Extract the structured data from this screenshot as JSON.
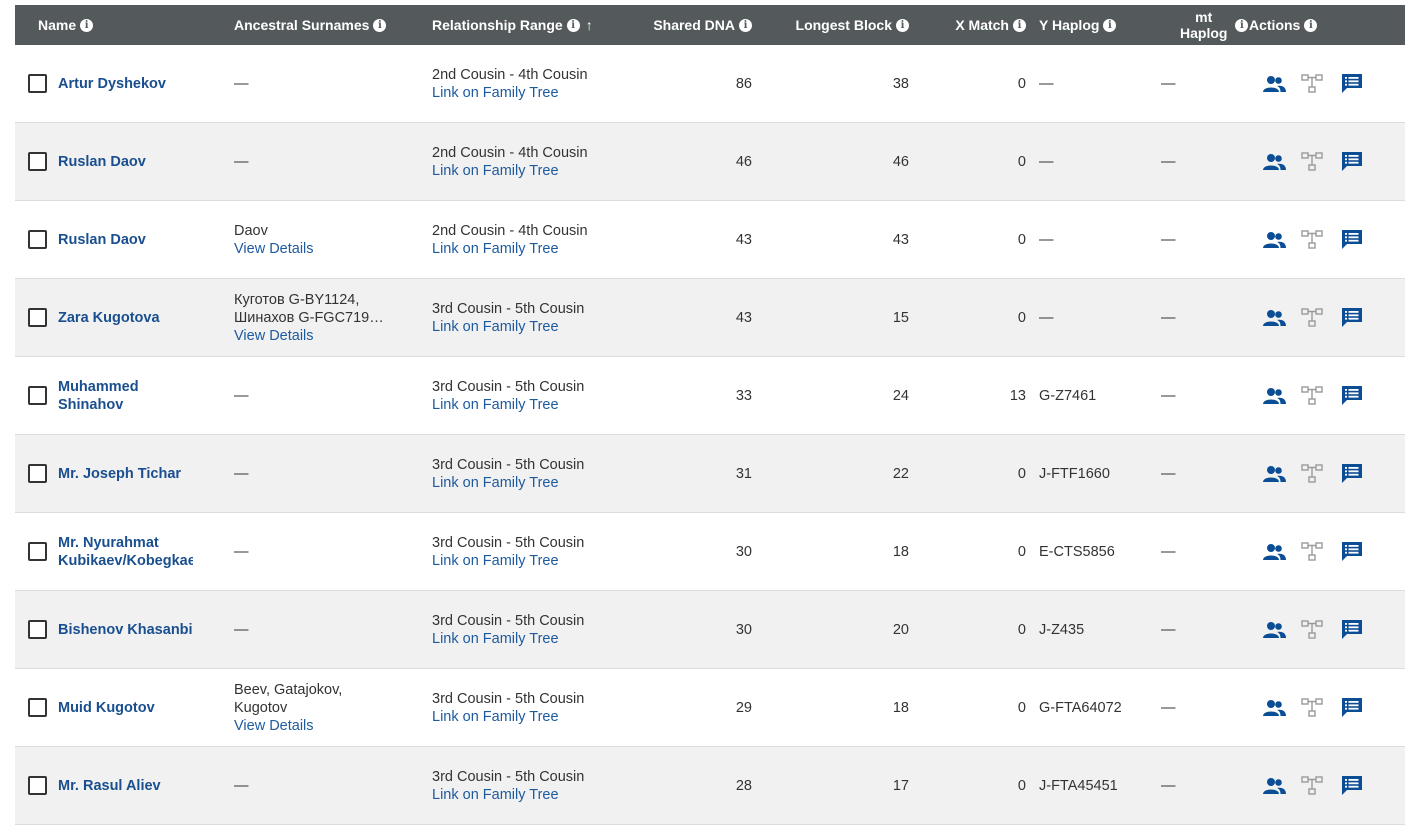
{
  "header": {
    "name": "Name",
    "surnames": "Ancestral Surnames",
    "relationship": "Relationship Range",
    "shared_dna": "Shared DNA",
    "longest_block": "Longest Block",
    "x_match": "X Match",
    "y_haplog": "Y Haplog",
    "mt_haplog_line1": "mt",
    "mt_haplog_line2": "Haplog",
    "actions": "Actions",
    "info_glyph": "i",
    "sort_glyph": "↑"
  },
  "rows": [
    {
      "name1": "Artur Dyshekov",
      "name2": "",
      "surn1": "—",
      "surn2": "",
      "surn_link": "",
      "rel": "2nd Cousin - 4th Cousin",
      "rel_link": "Link on Family Tree",
      "dna": "86",
      "block": "38",
      "x": "0",
      "y": "—",
      "mt": "—"
    },
    {
      "name1": "Ruslan Daov",
      "name2": "",
      "surn1": "—",
      "surn2": "",
      "surn_link": "",
      "rel": "2nd Cousin - 4th Cousin",
      "rel_link": "Link on Family Tree",
      "dna": "46",
      "block": "46",
      "x": "0",
      "y": "—",
      "mt": "—"
    },
    {
      "name1": "Ruslan Daov",
      "name2": "",
      "surn1": "Daov",
      "surn2": "",
      "surn_link": "View Details",
      "rel": "2nd Cousin - 4th Cousin",
      "rel_link": "Link on Family Tree",
      "dna": "43",
      "block": "43",
      "x": "0",
      "y": "—",
      "mt": "—"
    },
    {
      "name1": "Zara Kugotova",
      "name2": "",
      "surn1": "Куготов G-BY1124,",
      "surn2": "Шинахов G-FGC719,...",
      "surn_link": "View Details",
      "rel": "3rd Cousin - 5th Cousin",
      "rel_link": "Link on Family Tree",
      "dna": "43",
      "block": "15",
      "x": "0",
      "y": "—",
      "mt": "—"
    },
    {
      "name1": "Muhammed",
      "name2": "Shinahov",
      "surn1": "—",
      "surn2": "",
      "surn_link": "",
      "rel": "3rd Cousin - 5th Cousin",
      "rel_link": "Link on Family Tree",
      "dna": "33",
      "block": "24",
      "x": "13",
      "y": "G-Z7461",
      "mt": "—"
    },
    {
      "name1": "Mr. Joseph Tichar",
      "name2": "",
      "surn1": "—",
      "surn2": "",
      "surn_link": "",
      "rel": "3rd Cousin - 5th Cousin",
      "rel_link": "Link on Family Tree",
      "dna": "31",
      "block": "22",
      "x": "0",
      "y": "J-FTF1660",
      "mt": "—"
    },
    {
      "name1": "Mr. Nyurahmat",
      "name2": "Kubikaev/Kobegkaev",
      "surn1": "—",
      "surn2": "",
      "surn_link": "",
      "rel": "3rd Cousin - 5th Cousin",
      "rel_link": "Link on Family Tree",
      "dna": "30",
      "block": "18",
      "x": "0",
      "y": "E-CTS5856",
      "mt": "—"
    },
    {
      "name1": "Bishenov Khasanbi",
      "name2": "",
      "surn1": "—",
      "surn2": "",
      "surn_link": "",
      "rel": "3rd Cousin - 5th Cousin",
      "rel_link": "Link on Family Tree",
      "dna": "30",
      "block": "20",
      "x": "0",
      "y": "J-Z435",
      "mt": "—"
    },
    {
      "name1": "Muid Kugotov",
      "name2": "",
      "surn1": "Beev, Gatajokov,",
      "surn2": "Kugotov",
      "surn_link": "View Details",
      "rel": "3rd Cousin - 5th Cousin",
      "rel_link": "Link on Family Tree",
      "dna": "29",
      "block": "18",
      "x": "0",
      "y": "G-FTA64072",
      "mt": "—"
    },
    {
      "name1": "Mr. Rasul Aliev",
      "name2": "",
      "surn1": "—",
      "surn2": "",
      "surn_link": "",
      "rel": "3rd Cousin - 5th Cousin",
      "rel_link": "Link on Family Tree",
      "dna": "28",
      "block": "17",
      "x": "0",
      "y": "J-FTA45451",
      "mt": "—"
    }
  ],
  "icons": {
    "people": "people-icon",
    "tree": "family-tree-icon",
    "message": "message-icon"
  },
  "colors": {
    "header_bg": "#54595b",
    "link": "#1d5a9e",
    "name": "#1a4f8f",
    "icon_blue": "#0b4e96",
    "icon_gray": "#9a9a9a"
  }
}
